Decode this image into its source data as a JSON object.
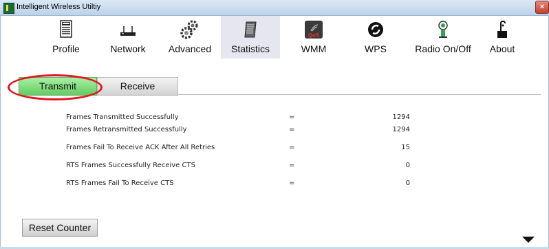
{
  "window": {
    "title": "Intelligent Wireless Utiltiy",
    "close_label": "×"
  },
  "toolbar": {
    "items": [
      {
        "label": "Profile",
        "icon": "profile-icon"
      },
      {
        "label": "Network",
        "icon": "network-icon"
      },
      {
        "label": "Advanced",
        "icon": "advanced-icon"
      },
      {
        "label": "Statistics",
        "icon": "statistics-icon",
        "active": true
      },
      {
        "label": "WMM",
        "icon": "wmm-icon"
      },
      {
        "label": "WPS",
        "icon": "wps-icon"
      },
      {
        "label": "Radio On/Off",
        "icon": "radio-icon"
      },
      {
        "label": "About",
        "icon": "about-icon"
      }
    ],
    "wmm_badge": "QoS"
  },
  "tabs": {
    "transmit": "Transmit",
    "receive": "Receive"
  },
  "stats": [
    {
      "label": "Frames Transmitted Successfully",
      "eq": "=",
      "value": "1294"
    },
    {
      "label": "Frames Retransmitted Successfully",
      "eq": "=",
      "value": "1294"
    },
    {
      "label": "Frames Fail To Receive ACK After All Retries",
      "eq": "=",
      "value": "15"
    },
    {
      "label": "RTS Frames Successfully Receive CTS",
      "eq": "=",
      "value": "0"
    },
    {
      "label": "RTS Frames Fail To Receive CTS",
      "eq": "=",
      "value": "0"
    }
  ],
  "reset_label": "Reset Counter",
  "colors": {
    "active_tab": "#63cc62",
    "highlight": "#e0151d",
    "close": "#c2412d"
  }
}
